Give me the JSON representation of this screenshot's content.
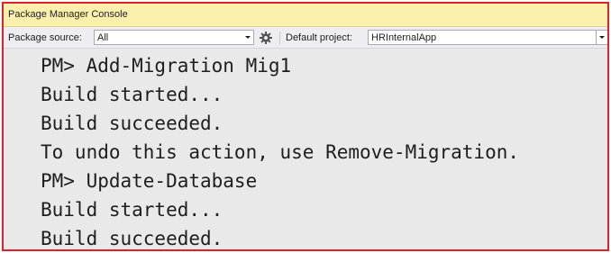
{
  "window": {
    "title": "Package Manager Console"
  },
  "toolbar": {
    "package_source_label": "Package source:",
    "package_source_value": "All",
    "settings_icon": "gear-icon",
    "default_project_label": "Default project:",
    "default_project_value": "HRInternalApp"
  },
  "console": {
    "lines": [
      "PM> Add-Migration Mig1",
      "Build started...",
      "Build succeeded.",
      "To undo this action, use Remove-Migration.",
      "PM> Update-Database",
      "Build started...",
      "Build succeeded."
    ]
  },
  "colors": {
    "titlebar_background": "#fcf0ad",
    "highlight_border": "#e0202a",
    "console_background": "#e9e9e9"
  }
}
